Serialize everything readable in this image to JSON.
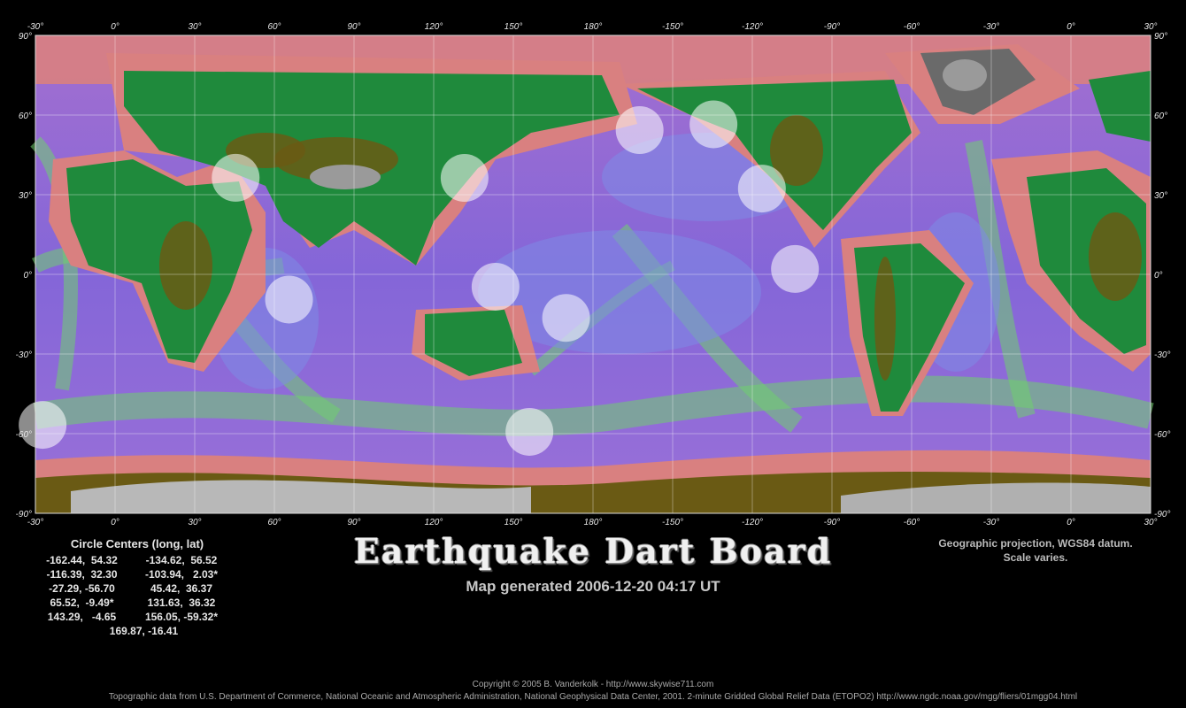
{
  "map": {
    "top_lon_labels": [
      "-30°",
      "0°",
      "30°",
      "60°",
      "90°",
      "120°",
      "150°",
      "180°",
      "-150°",
      "-120°",
      "-90°",
      "-60°",
      "-30°",
      "0°",
      "30°"
    ],
    "bottom_lon_labels": [
      "-30°",
      "0°",
      "30°",
      "60°",
      "90°",
      "120°",
      "150°",
      "180°",
      "-150°",
      "-120°",
      "-90°",
      "-60°",
      "-30°",
      "0°",
      "30°"
    ],
    "left_lat_labels": [
      "90°",
      "60°",
      "30°",
      "0°",
      "-30°",
      "-60°",
      "-90°"
    ],
    "right_lat_labels": [
      "90°",
      "60°",
      "30°",
      "0°",
      "-30°",
      "-60°",
      "-90°"
    ],
    "lon_range": [
      -30,
      390
    ],
    "lat_range": [
      -90,
      90
    ],
    "colors": {
      "ocean_deep": "#8a5ed6",
      "ocean_mid": "#7d8ae6",
      "ocean_shallow": "#63d46a",
      "shelf": "#d98080",
      "land_low": "#1f8a3c",
      "land_high": "#6a5a14",
      "mountain": "#9a9a9a",
      "ice": "#b8b8b8",
      "circle_fill": "#ffffff"
    },
    "circles": [
      {
        "lon": -162.44,
        "lat": 54.32
      },
      {
        "lon": -134.62,
        "lat": 56.52
      },
      {
        "lon": -116.39,
        "lat": 32.3
      },
      {
        "lon": -103.94,
        "lat": 2.03
      },
      {
        "lon": -27.29,
        "lat": -56.7
      },
      {
        "lon": 45.42,
        "lat": 36.37
      },
      {
        "lon": 65.52,
        "lat": -9.49
      },
      {
        "lon": 131.63,
        "lat": 36.32
      },
      {
        "lon": 143.29,
        "lat": -4.65
      },
      {
        "lon": 156.05,
        "lat": -59.32
      },
      {
        "lon": 169.87,
        "lat": -16.41
      }
    ]
  },
  "legend": {
    "title": "Circle Centers (long, lat)",
    "rows": [
      [
        "-162.44,  54.32",
        "-134.62,  56.52"
      ],
      [
        "-116.39,  32.30",
        "-103.94,   2.03*"
      ],
      [
        "-27.29, -56.70",
        "45.42,  36.37"
      ],
      [
        "65.52,  -9.49*",
        "131.63,  36.32"
      ],
      [
        "143.29,   -4.65",
        "156.05, -59.32*"
      ]
    ],
    "last": "169.87, -16.41"
  },
  "title": "Earthquake Dart Board",
  "subtitle": "Map generated 2006-12-20 04:17 UT",
  "projection": [
    "Geographic projection, WGS84 datum.",
    "Scale varies."
  ],
  "copyright": "Copyright © 2005 B. Vanderkolk - http://www.skywise711.com",
  "source": "Topographic data from U.S. Department of Commerce, National Oceanic and Atmospheric Administration, National Geophysical Data Center, 2001. 2-minute Gridded Global Relief Data (ETOPO2) http://www.ngdc.noaa.gov/mgg/fliers/01mgg04.html"
}
